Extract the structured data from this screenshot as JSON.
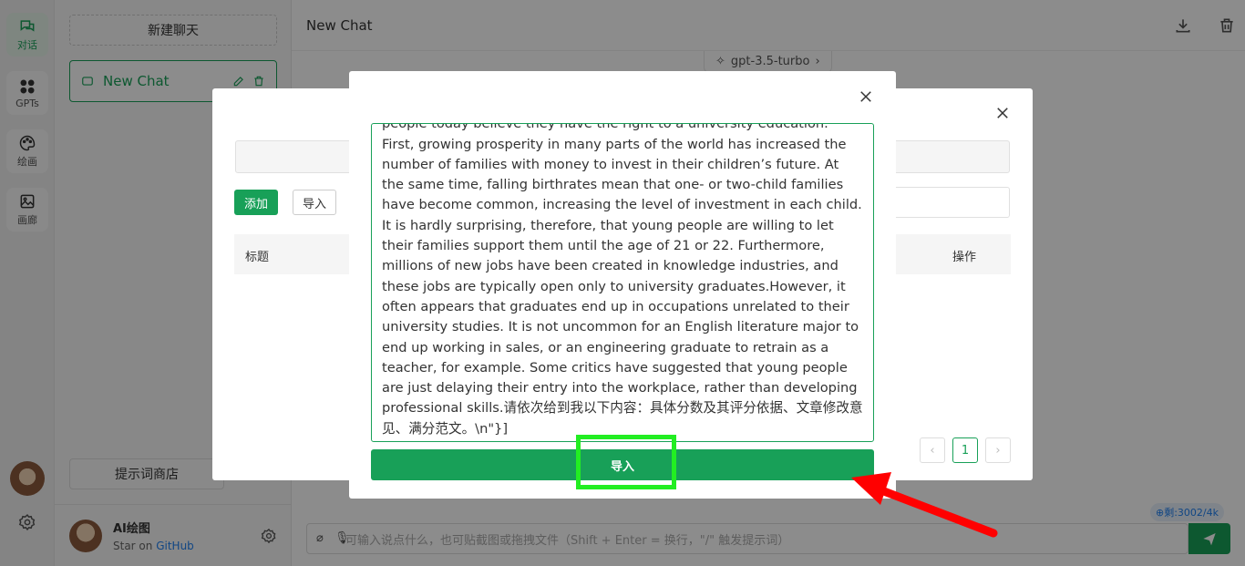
{
  "rail": {
    "items": [
      {
        "label": "对话",
        "icon": "chat-bubbles-icon",
        "active": true
      },
      {
        "label": "GPTs",
        "icon": "grid-icon",
        "active": false
      },
      {
        "label": "绘画",
        "icon": "palette-icon",
        "active": false
      },
      {
        "label": "画廊",
        "icon": "image-icon",
        "active": false
      }
    ],
    "settings_icon": "gear-icon",
    "avatar_icon": "user-avatar"
  },
  "sidebar": {
    "new_chat_label": "新建聊天",
    "chat_item": {
      "title": "New Chat",
      "icons": [
        "chat-icon",
        "edit-icon",
        "delete-icon"
      ]
    },
    "prompt_store_label": "提示词商店",
    "footer": {
      "name": "AI绘图",
      "star_prefix": "Star on",
      "github": "GitHub",
      "settings_icon": "gear-icon"
    }
  },
  "main": {
    "title": "New Chat",
    "model": "gpt-3.5-turbo",
    "download_icon": "download-icon",
    "delete_icon": "trash-icon",
    "input_placeholder": "可输入说点什么，也可贴截图或拖拽文件（Shift + Enter = 换行，\"/\" 触发提示词）",
    "token_badge": "⊕剩:3002/4k",
    "send_icon": "send-icon"
  },
  "store_modal": {
    "add_label": "添加",
    "import_label": "导入",
    "col_title": "标题",
    "col_action": "操作",
    "page": "1",
    "prev_icon": "chevron-left-icon",
    "next_icon": "chevron-right-icon",
    "close_icon": "close-icon"
  },
  "import_modal": {
    "text": "the workplace. In this essay, I will examine both sides of this argument and try to reach a conclusion.There are several reasons why young people today believe they have the right to a university education. First, growing prosperity in many parts of the world has increased the number of families with money to invest in their children’s future. At the same time, falling birthrates mean that one- or two-child families have become common, increasing the level of investment in each child. It is hardly surprising, therefore, that young people are willing to let their families support them until the age of 21 or 22. Furthermore, millions of new jobs have been created in knowledge industries, and these jobs are typically open only to university graduates.However, it often appears that graduates end up in occupations unrelated to their university studies. It is not uncommon for an English literature major to end up working in sales, or an engineering graduate to retrain as a teacher, for example. Some critics have suggested that young people are just delaying their entry into the workplace, rather than developing professional skills.请依次给到我以下内容：具体分数及其评分依据、文章修改意见、满分范文。\\n\"}]",
    "submit_label": "导入",
    "close_icon": "close-icon"
  },
  "colors": {
    "accent": "#18a058",
    "highlight": "#22ee22",
    "arrow": "#ff0000"
  }
}
